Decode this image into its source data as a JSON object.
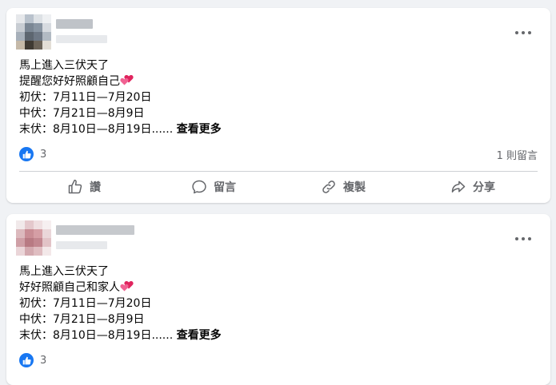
{
  "posts": [
    {
      "lines": [
        "馬上進入三伏天了",
        "提醒您好好照顧自己",
        "初伏：7月11日—7月20日",
        "中伏：7月21日—8月9日"
      ],
      "last_line": "末伏：8月10日—8月19日......",
      "see_more": "查看更多",
      "like_count": "3",
      "comment_count": "1 則留言"
    },
    {
      "lines": [
        "馬上進入三伏天了",
        "好好照顧自己和家人",
        "初伏：7月11日—7月20日",
        "中伏：7月21日—8月9日"
      ],
      "last_line": "末伏：8月10日—8月19日......",
      "see_more": "查看更多",
      "like_count": "3"
    }
  ],
  "actions": {
    "like": "讚",
    "comment": "留言",
    "copy": "複製",
    "share": "分享"
  },
  "icons": {
    "more": "more-horizontal-icon",
    "like_reaction": "like-reaction-icon",
    "heart": "two-hearts-emoji",
    "like": "thumbs-up-icon",
    "comment": "comment-bubble-icon",
    "copy": "link-icon",
    "share": "share-arrow-icon"
  }
}
